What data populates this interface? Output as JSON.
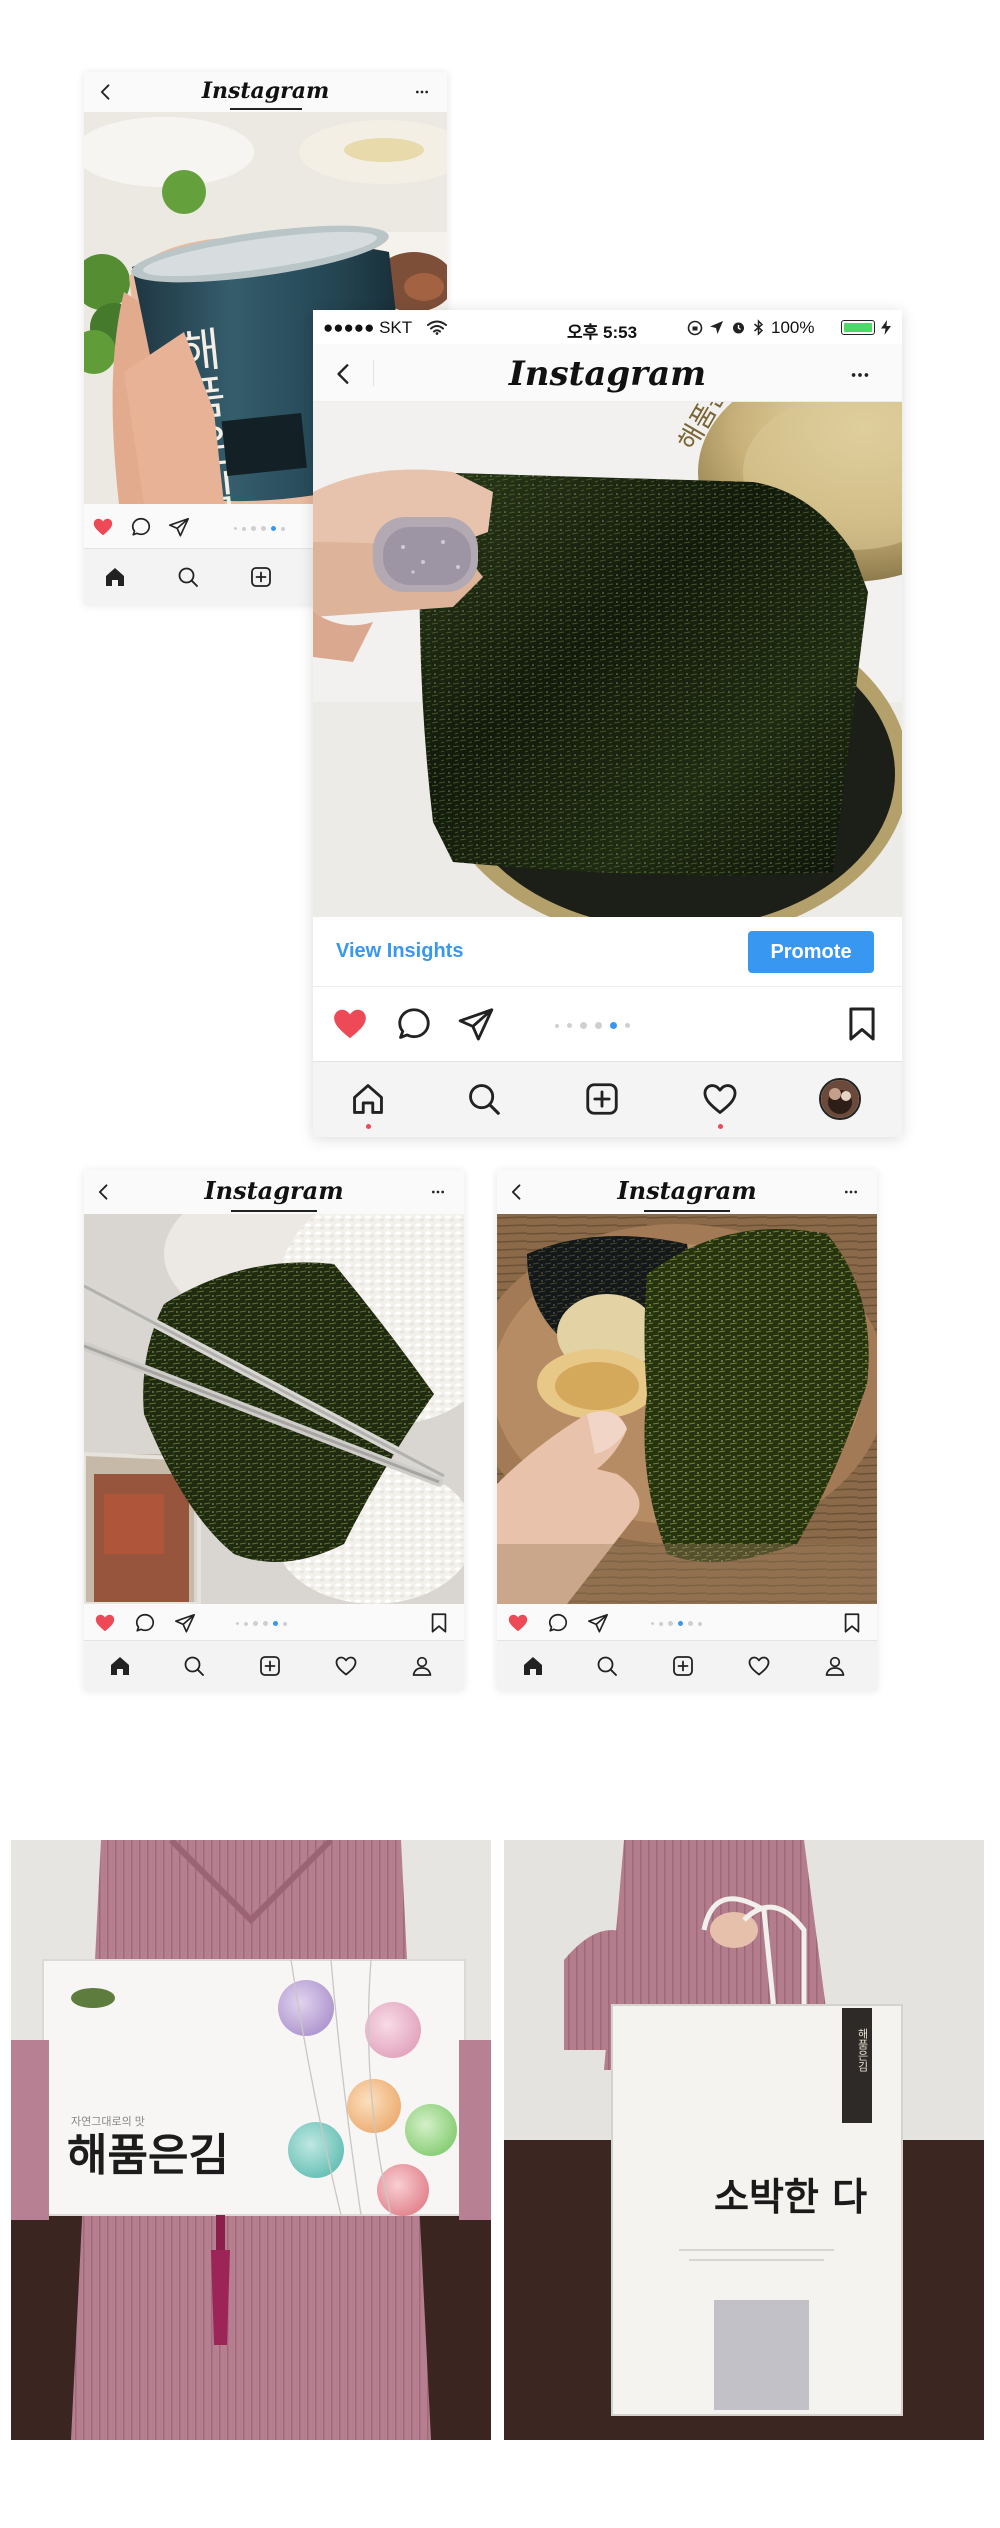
{
  "app": {
    "brand_title": "Instagram"
  },
  "status_bar": {
    "carrier": "●●●●● SKT",
    "time": "오후 5:53",
    "battery": "100%"
  },
  "actions": {
    "view_insights_label": "View Insights",
    "promote_label": "Promote"
  },
  "product": {
    "can_label": "해품은김",
    "can_subtitle": "자연그대로의 맛",
    "box_label": "해품은김",
    "box_subtitle": "자연그대로의 맛",
    "bag_label": "소박한 다",
    "bag_tag": "해품은김"
  },
  "colors": {
    "accent_blue": "#3897f0",
    "like_red": "#ed4956",
    "nav_bg": "#f3f3f3"
  },
  "icons": [
    "back-chevron-icon",
    "more-icon",
    "heart-icon",
    "comment-icon",
    "share-icon",
    "bookmark-icon",
    "home-icon",
    "search-icon",
    "add-post-icon",
    "activity-heart-icon",
    "profile-icon",
    "wifi-icon",
    "bluetooth-icon",
    "alarm-icon",
    "location-icon",
    "charging-icon"
  ]
}
